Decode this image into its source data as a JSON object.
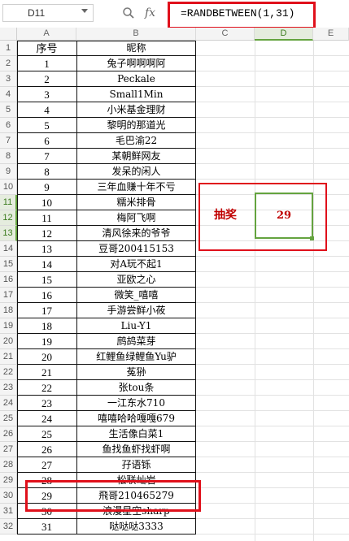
{
  "formula_bar": {
    "name_box": "D11",
    "fx_label": "fx",
    "formula": "=RANDBETWEEN(1,31)"
  },
  "columns": [
    "A",
    "B",
    "C",
    "D",
    "E"
  ],
  "rows": [
    "1",
    "2",
    "3",
    "4",
    "5",
    "6",
    "7",
    "8",
    "9",
    "10",
    "11",
    "12",
    "13",
    "14",
    "15",
    "16",
    "17",
    "18",
    "19",
    "20",
    "21",
    "22",
    "23",
    "24",
    "25",
    "26",
    "27",
    "28",
    "29",
    "30",
    "31",
    "32"
  ],
  "table": {
    "headers": [
      "序号",
      "昵称"
    ],
    "entries": [
      [
        "1",
        "兔子啊啊啊阿"
      ],
      [
        "2",
        "Peckale"
      ],
      [
        "3",
        "Small1Min"
      ],
      [
        "4",
        "小米基金理财"
      ],
      [
        "5",
        "黎明的那道光"
      ],
      [
        "6",
        "毛巴渝22"
      ],
      [
        "7",
        "某朝鲜网友"
      ],
      [
        "8",
        "发呆的闲人"
      ],
      [
        "9",
        "三年血赚十年不亏"
      ],
      [
        "10",
        "糯米排骨"
      ],
      [
        "11",
        "梅阿飞啊"
      ],
      [
        "12",
        "清风徐来的爷爷"
      ],
      [
        "13",
        "豆哥200415153"
      ],
      [
        "14",
        "对A玩不起1"
      ],
      [
        "15",
        "亚欧之心"
      ],
      [
        "16",
        "微笑_嘻嘻"
      ],
      [
        "17",
        "手游尝鲜小莜"
      ],
      [
        "18",
        "Liu-Y1"
      ],
      [
        "19",
        "鹧鸪菜芽"
      ],
      [
        "20",
        "红鲤鱼绿鲤鱼Yu驴"
      ],
      [
        "21",
        "菟狲"
      ],
      [
        "22",
        "张tou条"
      ],
      [
        "23",
        "一江东水710"
      ],
      [
        "24",
        "嘻嘻哈哈嘎嘎679"
      ],
      [
        "25",
        "生活像白菜1"
      ],
      [
        "26",
        "鱼找鱼虾找虾啊"
      ],
      [
        "27",
        "孖语铄"
      ],
      [
        "28",
        "松联屾岩"
      ],
      [
        "29",
        "飛哥210465279"
      ],
      [
        "30",
        "浪漫星空sharp"
      ],
      [
        "31",
        "哒哒哒3333"
      ]
    ]
  },
  "lottery": {
    "label": "抽奖",
    "result": "29"
  },
  "colors": {
    "highlight_red": "#e0101b",
    "selection_green": "#64a33f",
    "lottery_text": "#c00000"
  }
}
